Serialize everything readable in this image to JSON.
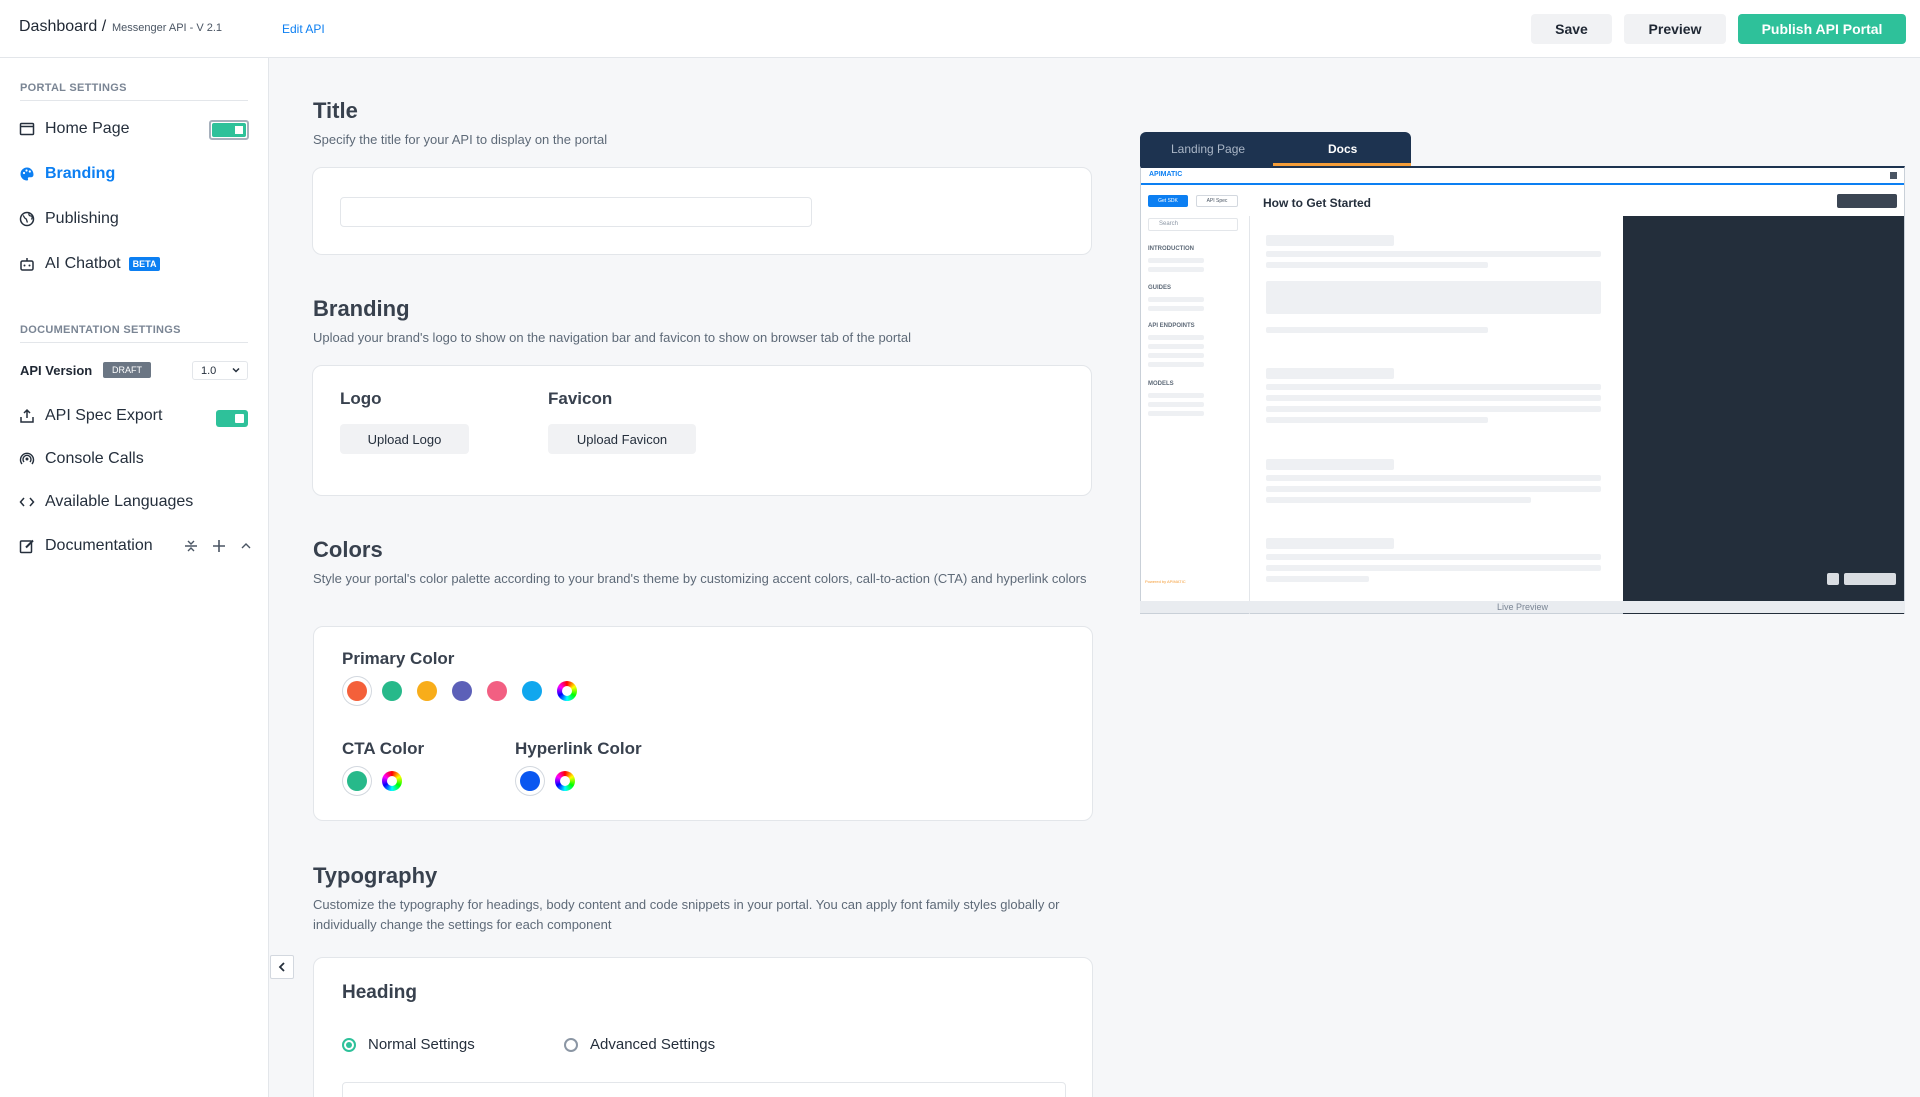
{
  "header": {
    "breadcrumb_root": "Dashboard /",
    "breadcrumb_sub": "Messenger API - V 2.1",
    "edit_link": "Edit API",
    "save_label": "Save",
    "preview_label": "Preview",
    "publish_label": "Publish API Portal"
  },
  "sidebar": {
    "portal_heading": "PORTAL SETTINGS",
    "portal_items": [
      {
        "label": "Home Page",
        "icon": "window-icon",
        "toggle_on": true
      },
      {
        "label": "Branding",
        "icon": "palette-icon",
        "active": true
      },
      {
        "label": "Publishing",
        "icon": "globe-icon"
      },
      {
        "label": "AI Chatbot",
        "icon": "robot-icon",
        "badge": "BETA"
      }
    ],
    "docs_heading": "DOCUMENTATION SETTINGS",
    "api_version_label": "API Version",
    "draft_badge": "DRAFT",
    "version_value": "1.0",
    "doc_items": [
      {
        "label": "API Spec Export",
        "icon": "export-icon",
        "toggle_on": true
      },
      {
        "label": "Console Calls",
        "icon": "signal-icon"
      },
      {
        "label": "Available Languages",
        "icon": "code-icon"
      },
      {
        "label": "Documentation",
        "icon": "edit-icon"
      }
    ]
  },
  "title_section": {
    "heading": "Title",
    "description": "Specify the title for your API to display on the portal",
    "input_value": ""
  },
  "branding_section": {
    "heading": "Branding",
    "description": "Upload your brand's logo to show on the navigation bar and favicon to show on browser tab of the portal",
    "logo_label": "Logo",
    "upload_logo": "Upload Logo",
    "favicon_label": "Favicon",
    "upload_favicon": "Upload Favicon"
  },
  "colors_section": {
    "heading": "Colors",
    "description": "Style your portal's color palette according to your brand's theme by customizing accent colors, call-to-action (CTA) and hyperlink colors",
    "primary_label": "Primary Color",
    "primary_swatches": [
      "#f4603a",
      "#27b98a",
      "#f8ad1a",
      "#5c60b8",
      "#f25f82",
      "#10a7ee"
    ],
    "cta_label": "CTA Color",
    "cta_swatch": "#27b98a",
    "hyperlink_label": "Hyperlink Color",
    "hyperlink_swatch": "#0a57f0"
  },
  "typography_section": {
    "heading": "Typography",
    "description": "Customize the typography for headings, body content and code snippets in your portal. You can apply font family styles globally or individually change the settings for each component",
    "card_heading": "Heading",
    "normal_settings": "Normal Settings",
    "advanced_settings": "Advanced Settings"
  },
  "preview": {
    "tab_landing": "Landing Page",
    "tab_docs": "Docs",
    "logo_text": "APIMATIC",
    "get_sdk": "Get SDK",
    "api_spec": "API Spec",
    "search_placeholder": "Search",
    "page_heading": "How to Get Started",
    "nav_introduction": "INTRODUCTION",
    "nav_guides": "GUIDES",
    "nav_endpoints": "API ENDPOINTS",
    "nav_models": "MODELS",
    "footer_brand": "Powered by APIMATIC",
    "caption": "Live Preview"
  }
}
